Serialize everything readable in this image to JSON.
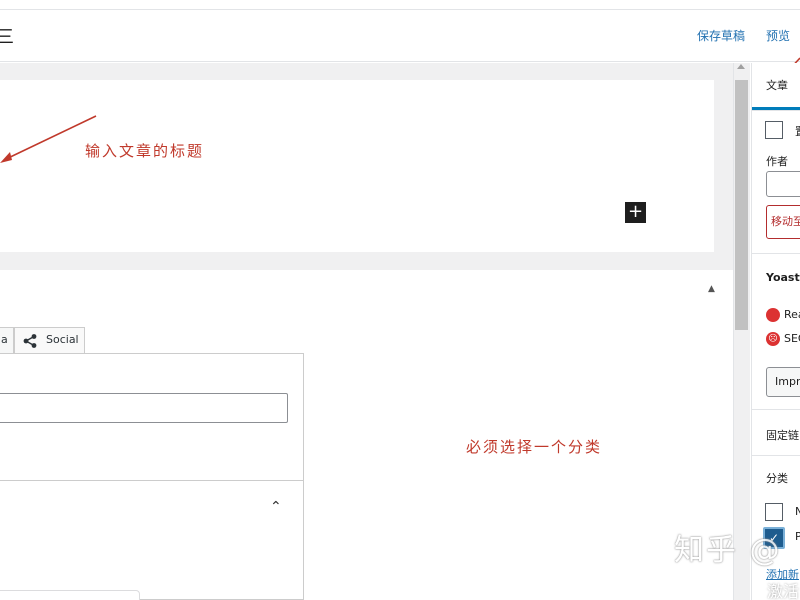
{
  "topbar": {
    "left_glyph": "三",
    "save_draft": "保存草稿",
    "preview": "预览"
  },
  "editor": {
    "annotation_title": "输入文章的标题",
    "annotation_category": "必须选择一个分类",
    "add_block_label": "+",
    "meta_tabs": [
      {
        "label": "a"
      },
      {
        "label": "Social",
        "icon": "share-icon"
      }
    ]
  },
  "sidebar": {
    "tab_label": "文章",
    "sticky_fragment": "置",
    "author_label": "作者",
    "trash_label": "移动至",
    "yoast_title": "Yoast S",
    "readability_fragment": "Rea",
    "seo_fragment": "SEO",
    "improve_label": "Impro",
    "permalink_label": "固定链",
    "categories_label": "分类",
    "category_one_fragment": "N",
    "category_two_fragment": "P",
    "add_category_link": "添加新"
  },
  "watermark": {
    "text": "知乎 @",
    "sub": "激活"
  },
  "colors": {
    "accent": "#2271b1",
    "annotation": "#c0392b",
    "status_red": "#dc3232",
    "tab_active": "#007cba"
  }
}
